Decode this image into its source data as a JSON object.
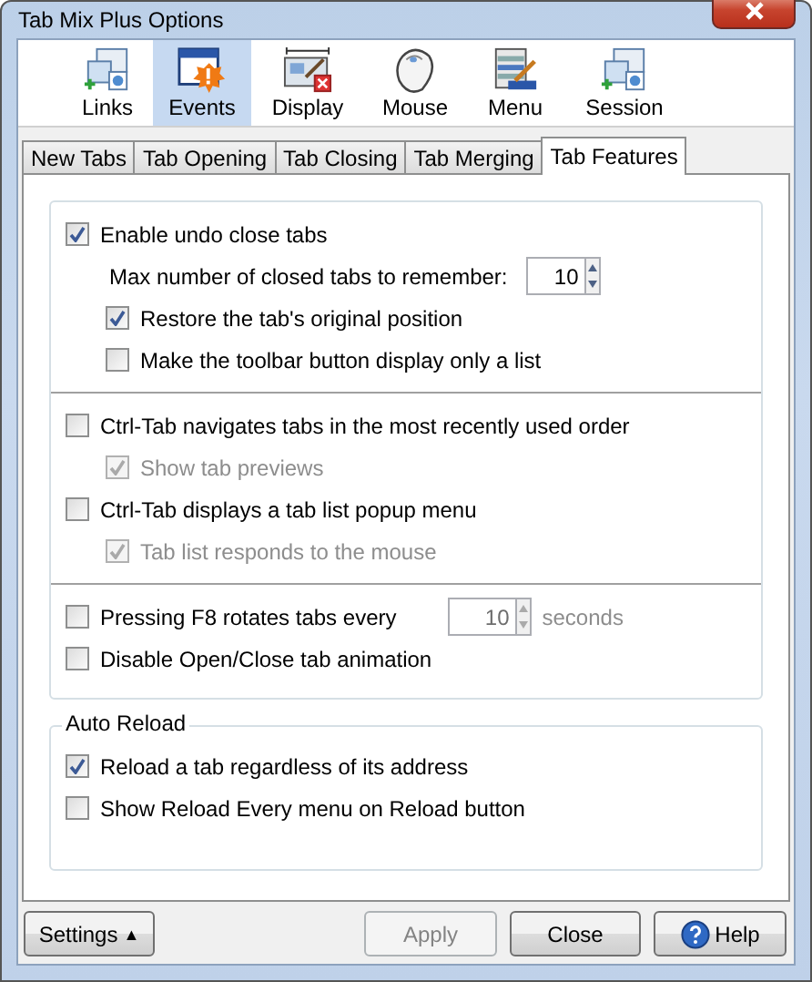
{
  "window": {
    "title": "Tab Mix Plus Options"
  },
  "toolbar": [
    {
      "label": "Links",
      "kind": "links",
      "selected": false
    },
    {
      "label": "Events",
      "kind": "events",
      "selected": true
    },
    {
      "label": "Display",
      "kind": "display",
      "selected": false
    },
    {
      "label": "Mouse",
      "kind": "mouse",
      "selected": false
    },
    {
      "label": "Menu",
      "kind": "menu",
      "selected": false
    },
    {
      "label": "Session",
      "kind": "session",
      "selected": false
    }
  ],
  "tabs": [
    {
      "label": "New Tabs",
      "selected": false
    },
    {
      "label": "Tab Opening",
      "selected": false
    },
    {
      "label": "Tab Closing",
      "selected": false
    },
    {
      "label": "Tab Merging",
      "selected": false
    },
    {
      "label": "Tab Features",
      "selected": true
    }
  ],
  "groups": [
    {
      "sections": [
        [
          {
            "kind": "checkbox",
            "label": "Enable undo close tabs",
            "checked": true,
            "disabled": false,
            "children": [
              {
                "kind": "number",
                "label": "Max number of closed tabs to remember:",
                "value": "10",
                "disabled": false
              },
              {
                "kind": "checkbox",
                "label": "Restore the tab's original position",
                "checked": true,
                "disabled": false
              },
              {
                "kind": "checkbox",
                "label": "Make the toolbar button display only a list",
                "checked": false,
                "disabled": false
              }
            ]
          }
        ],
        [
          {
            "kind": "checkbox",
            "label": "Ctrl-Tab navigates tabs in the most recently used order",
            "checked": false,
            "disabled": false,
            "children": [
              {
                "kind": "checkbox",
                "label": "Show tab previews",
                "checked": true,
                "disabled": true
              }
            ]
          },
          {
            "kind": "checkbox",
            "label": "Ctrl-Tab displays a tab list popup menu",
            "checked": false,
            "disabled": false,
            "children": [
              {
                "kind": "checkbox",
                "label": "Tab list responds to the mouse",
                "checked": true,
                "disabled": true
              }
            ]
          }
        ],
        [
          {
            "kind": "checkbox_number",
            "label": "Pressing F8 rotates tabs every",
            "checked": false,
            "disabled": false,
            "value": "10",
            "unit": "seconds",
            "field_disabled": true
          },
          {
            "kind": "checkbox",
            "label": "Disable Open/Close tab animation",
            "checked": false,
            "disabled": false
          }
        ]
      ]
    },
    {
      "caption": "Auto Reload",
      "sections": [
        [
          {
            "kind": "checkbox",
            "label": "Reload a tab regardless of its address",
            "checked": true,
            "disabled": false
          },
          {
            "kind": "checkbox",
            "label": "Show Reload Every menu on Reload button",
            "checked": false,
            "disabled": false
          }
        ]
      ]
    }
  ],
  "buttons": [
    {
      "label": "Settings",
      "arrow": "▲",
      "kind": "menu",
      "disabled": false
    },
    {
      "label": "Apply",
      "kind": "plain",
      "disabled": true
    },
    {
      "label": "Close",
      "kind": "plain",
      "disabled": false
    },
    {
      "label": "Help",
      "kind": "help",
      "disabled": false
    }
  ]
}
